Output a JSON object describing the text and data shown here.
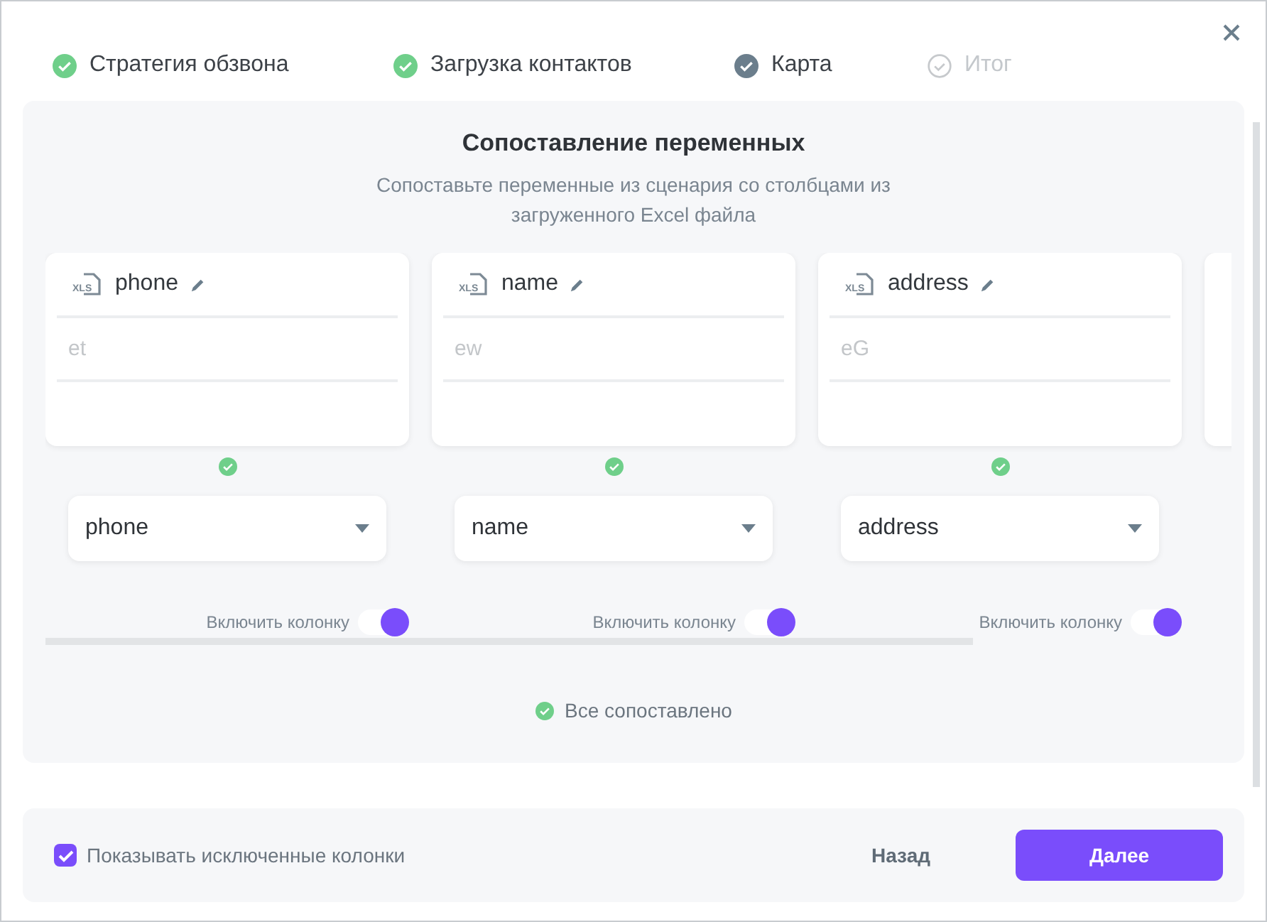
{
  "steps": [
    {
      "label": "Стратегия обзвона",
      "kind": "done"
    },
    {
      "label": "Загрузка контактов",
      "kind": "done"
    },
    {
      "label": "Карта",
      "kind": "current"
    },
    {
      "label": "Итог",
      "kind": "pending"
    }
  ],
  "title": "Сопоставление переменных",
  "subtitle": "Сопоставьте переменные из сценария со столбцами из загруженного Excel файла",
  "columns": [
    {
      "file_type": "XLS",
      "name": "phone",
      "placeholder": "et",
      "matched": true,
      "select": "phone",
      "toggle_label": "Включить колонку",
      "on": true
    },
    {
      "file_type": "XLS",
      "name": "name",
      "placeholder": "ew",
      "matched": true,
      "select": "name",
      "toggle_label": "Включить колонку",
      "on": true
    },
    {
      "file_type": "XLS",
      "name": "address",
      "placeholder": "eG",
      "matched": true,
      "select": "address",
      "toggle_label": "Включить колонку",
      "on": true
    }
  ],
  "status": "Все сопоставлено",
  "footer": {
    "show_excluded": {
      "label": "Показывать исключенные колонки",
      "checked": true
    },
    "back": "Назад",
    "next": "Далее"
  }
}
